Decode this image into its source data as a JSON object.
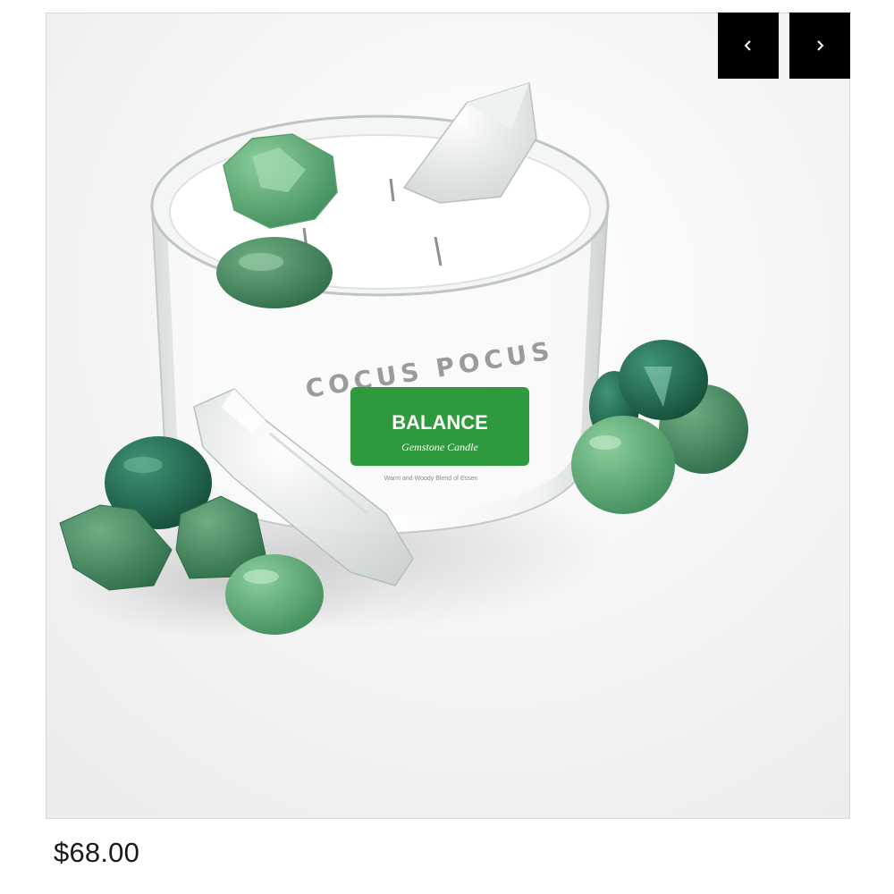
{
  "product": {
    "price": "$68.00",
    "image": {
      "brand_text": "COCUS POCUS",
      "label_title": "BALANCE",
      "label_subtitle": "Gemstone Candle",
      "label_fine_print": "Warm and Woody Blend of Essen",
      "label_color": "#2f9a3d"
    }
  },
  "gallery": {
    "prev_icon": "chevron-left-icon",
    "next_icon": "chevron-right-icon"
  }
}
